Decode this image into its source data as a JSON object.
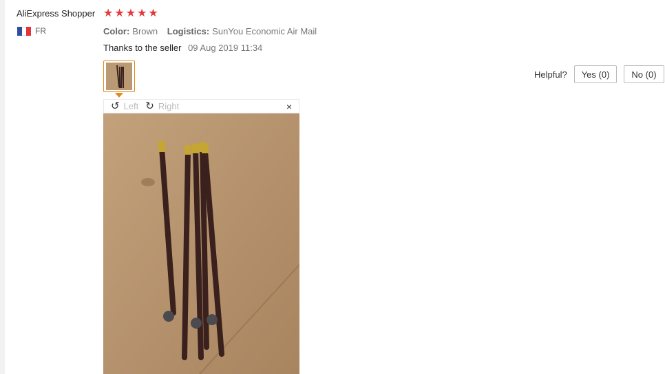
{
  "review": {
    "user_name": "AliExpress Shopper",
    "rating_stars": 5,
    "country_code": "FR",
    "attributes": [
      {
        "label": "Color:",
        "value": "Brown"
      },
      {
        "label": "Logistics:",
        "value": "SunYou Economic Air Mail"
      }
    ],
    "feedback_text": "Thanks to the seller",
    "date": "09 Aug 2019 11:34",
    "flag_colors": [
      "#2f4ea3",
      "#ffffff",
      "#e3343b"
    ],
    "accent_color": "#e38a1c",
    "star_color": "#e4393c"
  },
  "viewer": {
    "rotate_left_label": "Left",
    "rotate_right_label": "Right",
    "close_icon": "×",
    "rotate_left_icon": "↺",
    "rotate_right_icon": "↻"
  },
  "helpful": {
    "label": "Helpful?",
    "yes_label": "Yes (0)",
    "no_label": "No (0)"
  }
}
